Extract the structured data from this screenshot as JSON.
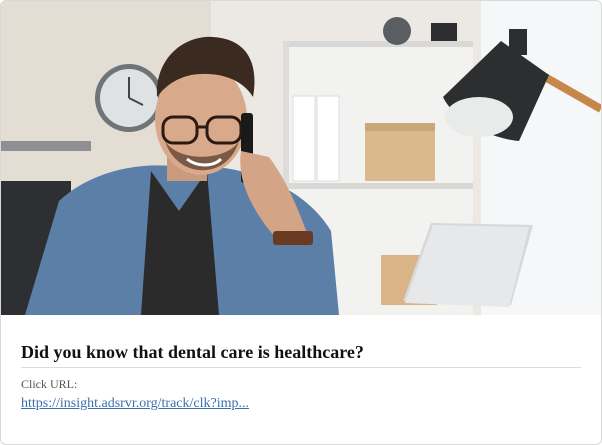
{
  "ad": {
    "image_alt": "Man with glasses smiling on phone call at desk with lamp and laptop",
    "title": "Did you know that dental care is healthcare?",
    "click_label": "Click URL:",
    "click_url": "https://insight.adsrvr.org/track/clk?imp..."
  },
  "colors": {
    "link": "#3a6fb0",
    "title": "#111111",
    "border": "#d9d9d9"
  }
}
